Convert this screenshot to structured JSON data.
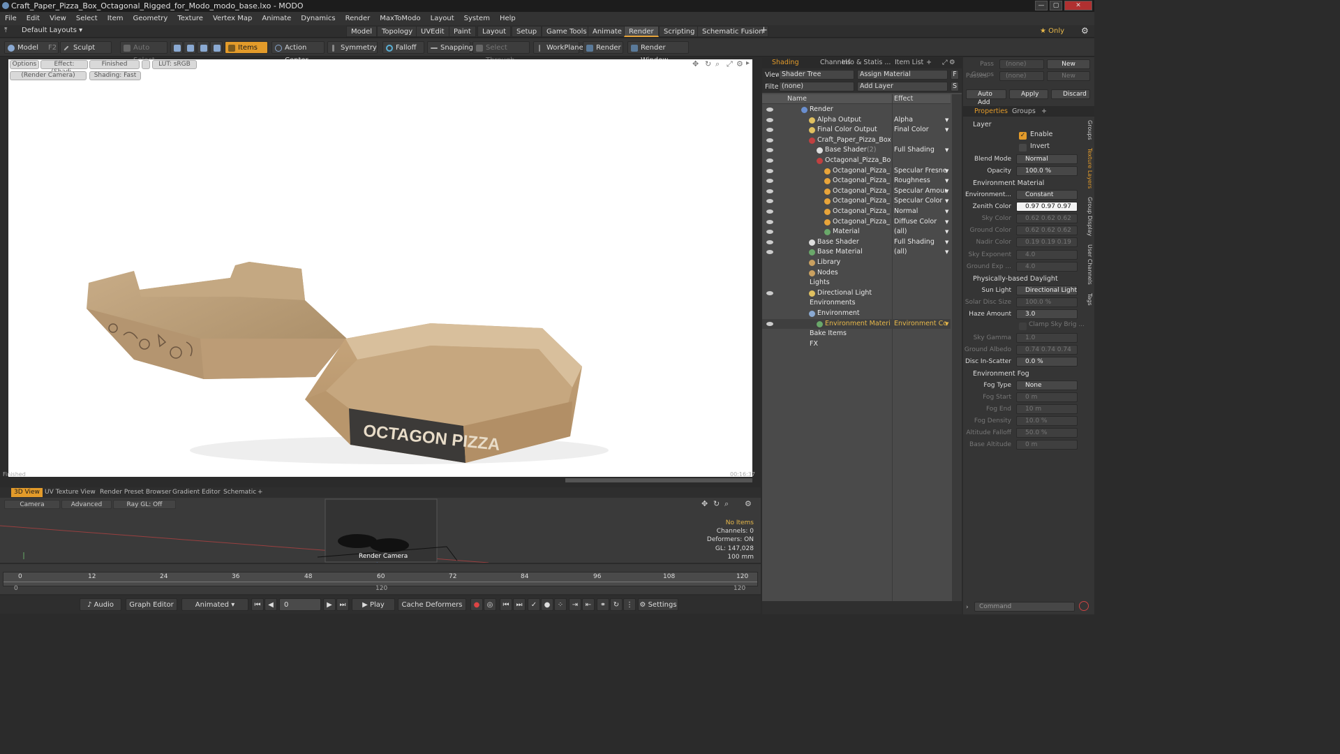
{
  "window": {
    "title": "Craft_Paper_Pizza_Box_Octagonal_Rigged_for_Modo_modo_base.lxo - MODO"
  },
  "menu": [
    "File",
    "Edit",
    "View",
    "Select",
    "Item",
    "Geometry",
    "Texture",
    "Vertex Map",
    "Animate",
    "Dynamics",
    "Render",
    "MaxToModo",
    "Layout",
    "System",
    "Help"
  ],
  "layout": {
    "default_layouts": "Default Layouts ▾",
    "tabs": [
      "Model",
      "Topology",
      "UVEdit",
      "Paint",
      "Layout",
      "Setup",
      "Game Tools",
      "Animate",
      "Render",
      "Scripting",
      "Schematic Fusion"
    ],
    "active_tab": "Render",
    "plus": "+",
    "only": "★ Only"
  },
  "toolbar": {
    "model": "Model",
    "f2": "F2",
    "sculpt": "Sculpt",
    "auto_select": "Auto Select",
    "items": "Items",
    "action_center": "Action Center",
    "symmetry": "Symmetry",
    "falloff": "Falloff",
    "snapping": "Snapping",
    "select_through": "Select Through",
    "workplane": "WorkPlane",
    "render": "Render",
    "render_window": "Render Window"
  },
  "viewport": {
    "options": "Options",
    "effect": "Effect: (Shadi...",
    "finished": "Finished",
    "lut": "LUT: sRGB",
    "render_camera": "(Render Camera)",
    "shading": "Shading: Fast",
    "box_text": "OCTAGON PIZZA",
    "status_left": "Finished",
    "status_right": "00:16:37"
  },
  "bottom_tabs": [
    "3D View",
    "UV Texture View",
    "Render Preset Browser",
    "Gradient Editor",
    "Schematic"
  ],
  "mini3d": {
    "camera": "Camera",
    "advanced": "Advanced",
    "raygl": "Ray GL: Off",
    "cam_label": "Render Camera",
    "stats": {
      "no_items": "No Items",
      "channels": "Channels: 0",
      "deformers": "Deformers: ON",
      "gl": "GL: 147,028",
      "size": "100 mm"
    }
  },
  "timeline": {
    "ticks": [
      "0",
      "12",
      "24",
      "36",
      "48",
      "60",
      "72",
      "84",
      "96",
      "108",
      "120"
    ],
    "sub_ticks": [
      "0",
      "120",
      "120"
    ]
  },
  "transport": {
    "audio": "Audio",
    "graph_editor": "Graph Editor",
    "animated": "Animated",
    "frame": "0",
    "play": "Play",
    "cache": "Cache Deformers",
    "settings": "Settings"
  },
  "shading_panel": {
    "tabs": [
      "Shading",
      "Channels",
      "Info & Statis ...",
      "Item List",
      "+"
    ],
    "view_label": "View",
    "view_value": "Shader Tree",
    "assign_material": "Assign Material",
    "f": "F",
    "filter_label": "Filter",
    "filter_value": "(none)",
    "add_layer": "Add Layer",
    "s": "S",
    "col_name": "Name",
    "col_effect": "Effect",
    "rows": [
      {
        "name": "Render",
        "effect": "",
        "indent": 0
      },
      {
        "name": "Alpha Output",
        "effect": "Alpha",
        "indent": 1
      },
      {
        "name": "Final Color Output",
        "effect": "Final Color",
        "indent": 1
      },
      {
        "name": "Craft_Paper_Pizza_Box_Oc...",
        "effect": "",
        "indent": 1
      },
      {
        "name": "Base Shader",
        "suffix": "(2)",
        "effect": "Full Shading",
        "indent": 2
      },
      {
        "name": "Octagonal_Pizza_Box_Cr...",
        "effect": "",
        "indent": 2
      },
      {
        "name": "Octagonal_Pizza_Box_...",
        "effect": "Specular Fresnel",
        "indent": 3
      },
      {
        "name": "Octagonal_Pizza_Box_...",
        "effect": "Roughness",
        "indent": 3
      },
      {
        "name": "Octagonal_Pizza_Box_...",
        "effect": "Specular Amount",
        "indent": 3
      },
      {
        "name": "Octagonal_Pizza_Box_...",
        "effect": "Specular Color",
        "indent": 3
      },
      {
        "name": "Octagonal_Pizza_Box_...",
        "effect": "Normal",
        "indent": 3
      },
      {
        "name": "Octagonal_Pizza_Box_...",
        "effect": "Diffuse Color",
        "indent": 3
      },
      {
        "name": "Material",
        "effect": "(all)",
        "indent": 3
      },
      {
        "name": "Base Shader",
        "effect": "Full Shading",
        "indent": 1
      },
      {
        "name": "Base Material",
        "effect": "(all)",
        "indent": 1
      },
      {
        "name": "Library",
        "effect": "",
        "indent": 1
      },
      {
        "name": "Nodes",
        "effect": "",
        "indent": 1
      },
      {
        "name": "Lights",
        "effect": "",
        "indent": 0
      },
      {
        "name": "Directional Light",
        "effect": "",
        "indent": 1
      },
      {
        "name": "Environments",
        "effect": "",
        "indent": 0
      },
      {
        "name": "Environment",
        "effect": "",
        "indent": 1
      },
      {
        "name": "Environment Material",
        "effect": "Environment Color",
        "indent": 2
      },
      {
        "name": "Bake Items",
        "effect": "",
        "indent": 0
      },
      {
        "name": "FX",
        "effect": "",
        "indent": 0
      }
    ]
  },
  "properties": {
    "pass_groups": "Pass Groups",
    "pass_none": "(none)",
    "new": "New",
    "passes": "Passes",
    "passes_none": "(none)",
    "passes_new": "New",
    "auto_add": "Auto Add",
    "apply": "Apply",
    "discard": "Discard",
    "tabs": [
      "Properties",
      "Groups",
      "+"
    ],
    "layer": "Layer",
    "enable": "Enable",
    "invert": "Invert",
    "blend_mode_label": "Blend Mode",
    "blend_mode": "Normal",
    "opacity_label": "Opacity",
    "opacity": "100.0 %",
    "env_material": "Environment Material",
    "environment_label": "Environment...",
    "environment": "Constant",
    "zenith_label": "Zenith Color",
    "zenith": "0.97  0.97  0.97",
    "sky_label": "Sky Color",
    "sky": "0.62  0.62  0.62",
    "ground_label": "Ground Color",
    "ground": "0.62  0.62  0.62",
    "nadir_label": "Nadir Color",
    "nadir": "0.19  0.19  0.19",
    "sky_exp_label": "Sky Exponent",
    "sky_exp": "4.0",
    "ground_exp_label": "Ground Exp ...",
    "ground_exp": "4.0",
    "daylight": "Physically-based Daylight",
    "sun_label": "Sun Light",
    "sun": "Directional Light",
    "solar_label": "Solar Disc Size",
    "solar": "100.0 %",
    "haze_label": "Haze Amount",
    "haze": "3.0",
    "clamp": "Clamp Sky Brig ...",
    "gamma_label": "Sky Gamma",
    "gamma": "1.0",
    "albedo_label": "Ground Albedo",
    "albedo": "0.74  0.74  0.74",
    "disc_label": "Disc In-Scatter",
    "disc": "0.0 %",
    "fog": "Environment Fog",
    "fog_type_label": "Fog Type",
    "fog_type": "None",
    "fog_start_label": "Fog Start",
    "fog_start": "0 m",
    "fog_end_label": "Fog End",
    "fog_end": "10 m",
    "fog_density_label": "Fog Density",
    "fog_density": "10.0 %",
    "alt_falloff_label": "Altitude Falloff",
    "alt_falloff": "50.0 %",
    "base_alt_label": "Base Altitude",
    "base_alt": "0 m",
    "command": "Command",
    "side_tabs": [
      "Groups",
      "Texture Layers",
      "Group Display",
      "User Channels",
      "Tags"
    ]
  },
  "colors": {
    "accent": "#e39b2a",
    "panel": "#2f2f2f",
    "viewport_bg": "#ffffff",
    "box": "#b89a74"
  }
}
